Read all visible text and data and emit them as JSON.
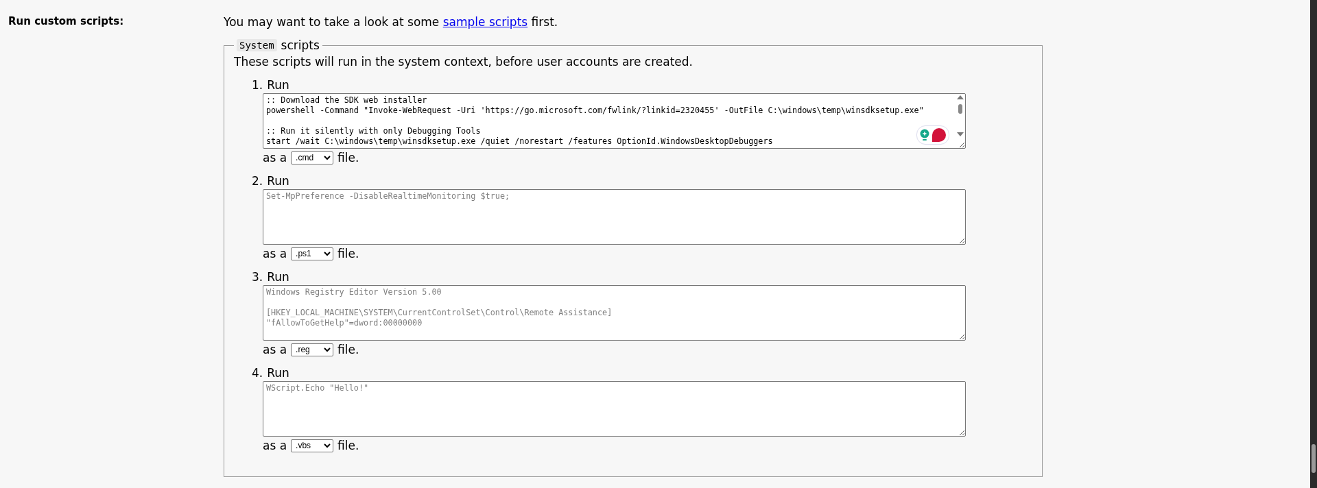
{
  "label": "Run custom scripts:",
  "intro": {
    "before": "You may want to take a look at some ",
    "link": "sample scripts",
    "after": " first."
  },
  "fieldset": {
    "legend_code": "System",
    "legend_text": "scripts",
    "description": "These scripts will run in the system context, before user accounts are created.",
    "scripts": [
      {
        "number": "1.",
        "heading": "Run",
        "value": ":: Download the SDK web installer\npowershell -Command \"Invoke-WebRequest -Uri 'https://go.microsoft.com/fwlink/?linkid=2320455' -OutFile C:\\windows\\temp\\winsdksetup.exe\"\n\n:: Run it silently with only Debugging Tools\nstart /wait C:\\windows\\temp\\winsdksetup.exe /quiet /norestart /features OptionId.WindowsDesktopDebuggers",
        "scrollable": true,
        "assistant": true,
        "prefix": "as a",
        "extension": ".cmd",
        "suffix": "file."
      },
      {
        "number": "2.",
        "heading": "Run",
        "placeholder": "Set-MpPreference -DisableRealtimeMonitoring $true;",
        "prefix": "as a",
        "extension": ".ps1",
        "suffix": "file."
      },
      {
        "number": "3.",
        "heading": "Run",
        "placeholder": "Windows Registry Editor Version 5.00\n\n[HKEY_LOCAL_MACHINE\\SYSTEM\\CurrentControlSet\\Control\\Remote Assistance]\n\"fAllowToGetHelp\"=dword:00000000",
        "prefix": "as a",
        "extension": ".reg",
        "suffix": "file."
      },
      {
        "number": "4.",
        "heading": "Run",
        "placeholder": "WScript.Echo \"Hello!\"",
        "prefix": "as a",
        "extension": ".vbs",
        "suffix": "file."
      }
    ]
  }
}
